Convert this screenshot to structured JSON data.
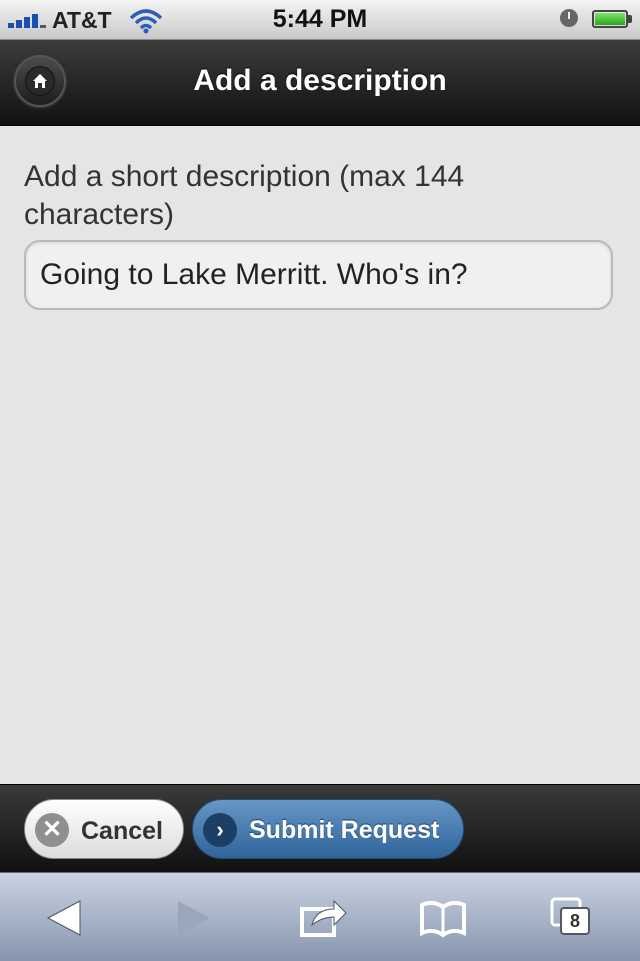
{
  "status_bar": {
    "carrier": "AT&T",
    "time": "5:44 PM"
  },
  "header": {
    "title": "Add a description",
    "home_icon": "home-icon"
  },
  "form": {
    "label": "Add a short description (max 144 characters)",
    "description_value": "Going to Lake Merritt. Who's in?"
  },
  "footer": {
    "cancel_label": "Cancel",
    "submit_label": "Submit Request"
  },
  "safari_toolbar": {
    "tab_count": "8",
    "icons": [
      "back-icon",
      "forward-icon",
      "share-icon",
      "bookmarks-icon",
      "tabs-icon"
    ]
  },
  "colors": {
    "header_bg": "#1c1c1c",
    "content_bg": "#e5e5e5",
    "submit_bg": "#3a6fa6",
    "toolbar_bg": "#a9b6ca"
  }
}
